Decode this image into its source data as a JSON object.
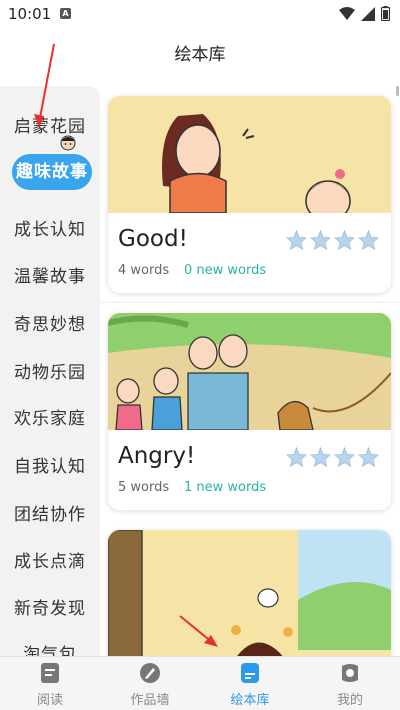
{
  "status_bar": {
    "time": "10:01",
    "notification_icon": "A"
  },
  "header": {
    "title": "绘本库"
  },
  "sidebar": {
    "items": [
      {
        "label": "启蒙花园"
      },
      {
        "label": "趣味故事",
        "active": true
      },
      {
        "label": "成长认知"
      },
      {
        "label": "温馨故事"
      },
      {
        "label": "奇思妙想"
      },
      {
        "label": "动物乐园"
      },
      {
        "label": "欢乐家庭"
      },
      {
        "label": "自我认知"
      },
      {
        "label": "团结协作"
      },
      {
        "label": "成长点滴"
      },
      {
        "label": "新奇发现"
      },
      {
        "label": "淘气包"
      }
    ]
  },
  "books": [
    {
      "title": "Good!",
      "words": "4 words",
      "new_words": "0 new words",
      "stars": 4
    },
    {
      "title": "Angry!",
      "words": "5 words",
      "new_words": "1 new words",
      "stars": 4
    },
    {
      "title": "",
      "words": "",
      "new_words": ""
    }
  ],
  "tabbar": {
    "tabs": [
      {
        "label": "阅读",
        "icon": "book-icon"
      },
      {
        "label": "作品墙",
        "icon": "pencil-icon"
      },
      {
        "label": "绘本库",
        "icon": "library-icon",
        "active": true
      },
      {
        "label": "我的",
        "icon": "profile-icon"
      }
    ]
  },
  "colors": {
    "accent": "#38a5ee",
    "new_words": "#26b5a0",
    "star": "#b9d3ea",
    "annotation_arrow": "#e53030"
  }
}
